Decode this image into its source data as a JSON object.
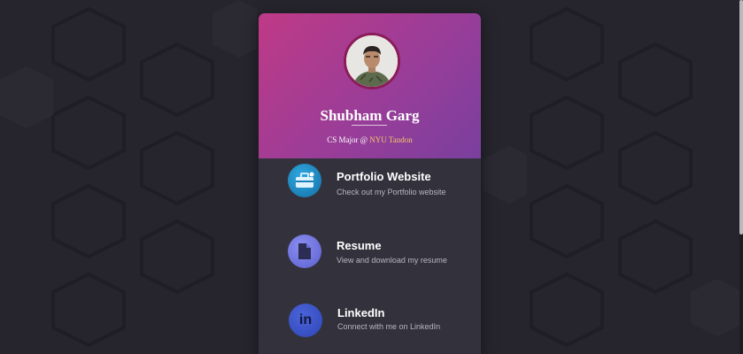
{
  "profile": {
    "name": "Shubham Garg",
    "tagline_prefix": "CS Major @ ",
    "tagline_highlight": "NYU Tandon"
  },
  "links": [
    {
      "title": "Portfolio Website",
      "subtitle": "Check out my Portfolio website",
      "icon": "briefcase-icon"
    },
    {
      "title": "Resume",
      "subtitle": "View and download my resume",
      "icon": "document-icon"
    },
    {
      "title": "LinkedIn",
      "subtitle": "Connect with me on LinkedIn",
      "icon": "linkedin-icon"
    }
  ],
  "colors": {
    "background": "#26252d",
    "card": "#33323c",
    "header_gradient_start": "#bf3a86",
    "header_gradient_end": "#7a3f9e",
    "highlight": "#f3c66a"
  }
}
